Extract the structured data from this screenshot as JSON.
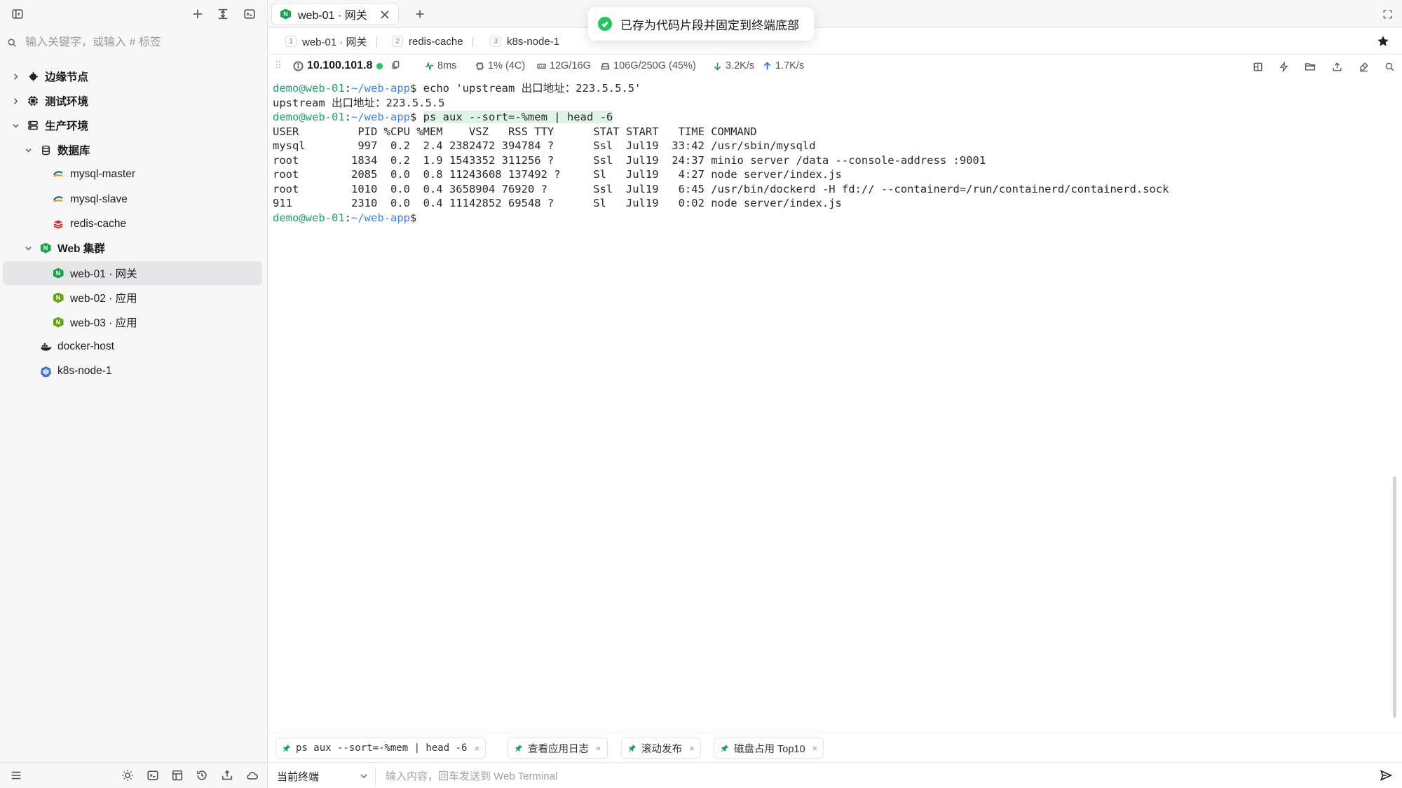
{
  "sidebar": {
    "search_placeholder": "输入关键字，或输入 # 标签",
    "tree": [
      {
        "label": "边缘节点",
        "bold": true
      },
      {
        "label": "测试环境",
        "bold": true
      },
      {
        "label": "生产环境",
        "bold": true
      },
      {
        "label": "数据库",
        "bold": true
      },
      {
        "label": "mysql-master"
      },
      {
        "label": "mysql-slave"
      },
      {
        "label": "redis-cache"
      },
      {
        "label": "Web 集群",
        "bold": true
      },
      {
        "label": "web-01 · 网关"
      },
      {
        "label": "web-02 · 应用"
      },
      {
        "label": "web-03 · 应用"
      },
      {
        "label": "docker-host"
      },
      {
        "label": "k8s-node-1"
      }
    ]
  },
  "tabs": {
    "active_title": "web-01 · 网关",
    "node_badge": "N"
  },
  "toast": {
    "message": "已存为代码片段并固定到终端底部"
  },
  "subtabs": [
    {
      "num": "1",
      "label": "web-01 · 网关"
    },
    {
      "num": "2",
      "label": "redis-cache"
    },
    {
      "num": "3",
      "label": "k8s-node-1"
    }
  ],
  "status": {
    "ip": "10.100.101.8",
    "latency": "8ms",
    "cpu": "1% (4C)",
    "memory": "12G/16G",
    "disk": "106G/250G (45%)",
    "download": "3.2K/s",
    "upload": "1.7K/s"
  },
  "terminal": {
    "prompt_user": "demo@web-01",
    "prompt_path": "~/web-app",
    "lines": [
      {
        "type": "prompt",
        "cmd": "echo 'upstream 出口地址：223.5.5.5'"
      },
      {
        "type": "out",
        "text": "upstream 出口地址：223.5.5.5"
      },
      {
        "type": "prompt",
        "cmd": "ps aux --sort=-%mem | head -6",
        "highlight": true
      },
      {
        "type": "out",
        "text": "USER         PID %CPU %MEM    VSZ   RSS TTY      STAT START   TIME COMMAND"
      },
      {
        "type": "out",
        "text": "mysql        997  0.2  2.4 2382472 394784 ?      Ssl  Jul19  33:42 /usr/sbin/mysqld"
      },
      {
        "type": "out",
        "text": "root        1834  0.2  1.9 1543352 311256 ?      Ssl  Jul19  24:37 minio server /data --console-address :9001"
      },
      {
        "type": "out",
        "text": "root        2085  0.0  0.8 11243608 137492 ?     Sl   Jul19   4:27 node server/index.js"
      },
      {
        "type": "out",
        "text": "root        1010  0.0  0.4 3658904 76920 ?       Ssl  Jul19   6:45 /usr/bin/dockerd -H fd:// --containerd=/run/containerd/containerd.sock"
      },
      {
        "type": "out",
        "text": "911         2310  0.0  0.4 11142852 69548 ?      Sl   Jul19   0:02 node server/index.js"
      },
      {
        "type": "prompt",
        "cmd": ""
      }
    ]
  },
  "snippets": [
    {
      "label": "ps aux --sort=-%mem | head -6",
      "mono": true
    },
    {
      "label": "查看应用日志"
    },
    {
      "label": "滚动发布"
    },
    {
      "label": "磁盘占用 Top10",
      "mono": true
    }
  ],
  "input": {
    "target": "当前终端",
    "placeholder": "输入内容，回车发送到 Web Terminal"
  },
  "colors": {
    "accent_green": "#22a06b",
    "path_blue": "#3b82f6",
    "node_green": "#16a34a"
  }
}
